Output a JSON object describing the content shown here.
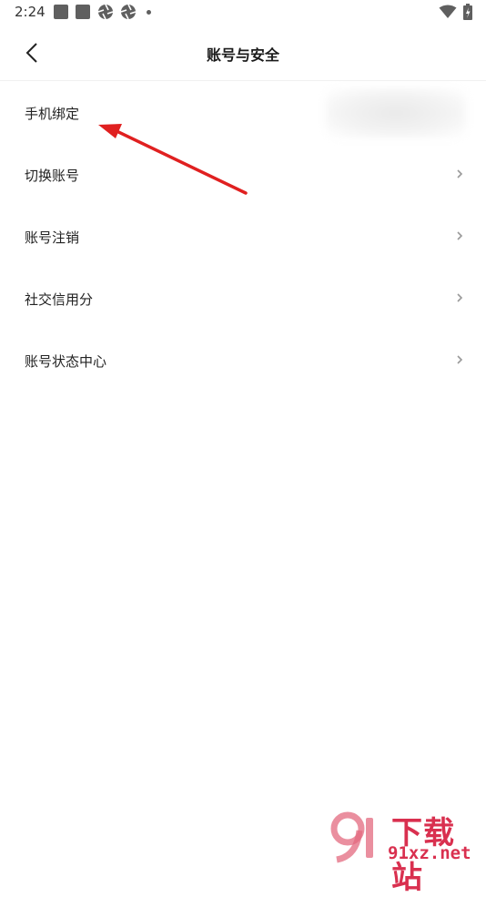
{
  "status_bar": {
    "time": "2:24"
  },
  "header": {
    "title": "账号与安全",
    "back_icon": "chevron-left-icon"
  },
  "list": {
    "items": [
      {
        "label": "手机绑定",
        "value_blurred": true,
        "chevron": false
      },
      {
        "label": "切换账号",
        "chevron": true
      },
      {
        "label": "账号注销",
        "chevron": true
      },
      {
        "label": "社交信用分",
        "chevron": true
      },
      {
        "label": "账号状态中心",
        "chevron": true
      }
    ]
  },
  "annotation": {
    "color": "#e02020",
    "icon": "red-arrow-icon"
  },
  "watermark": {
    "big_text": "下载站",
    "small_text": "91xz.net",
    "color": "#d9304f"
  }
}
